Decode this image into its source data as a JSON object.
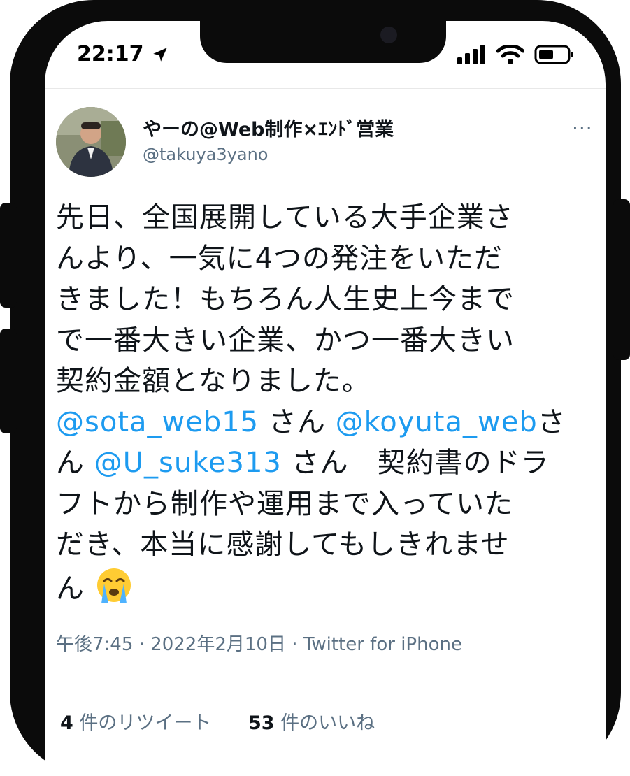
{
  "status_bar": {
    "time": "22:17"
  },
  "tweet": {
    "display_name": "やーの@Web制作×ｴﾝﾄﾞ営業",
    "handle": "@takuya3yano",
    "more_label": "···",
    "lines": [
      [
        "先日、全国展開している大手企業さ"
      ],
      [
        "んより、一気に4つの発注をいただ"
      ],
      [
        "きました！もちろん人生史上今まで"
      ],
      [
        "で一番大きい企業、かつ一番大きい"
      ],
      [
        "契約金額となりました。"
      ]
    ],
    "mentions": {
      "m1": "@sota_web15",
      "s1": " さん ",
      "m2": "@koyuta_web",
      "s2": "さ",
      "s3": "ん ",
      "m3": "@U_suke313",
      "s4": " さん　契約書のドラ"
    },
    "lines_after": [
      [
        "フトから制作や運用まで入っていた"
      ],
      [
        "だき、本当に感謝してもしきれませ"
      ],
      [
        "ん"
      ]
    ],
    "emoji_name": "loudly-crying-face",
    "meta": "午後7:45 · 2022年2月10日 · Twitter for iPhone",
    "retweets": {
      "count": "4",
      "label": " 件のリツイート"
    },
    "likes": {
      "count": "53",
      "label": " 件のいいね"
    }
  }
}
